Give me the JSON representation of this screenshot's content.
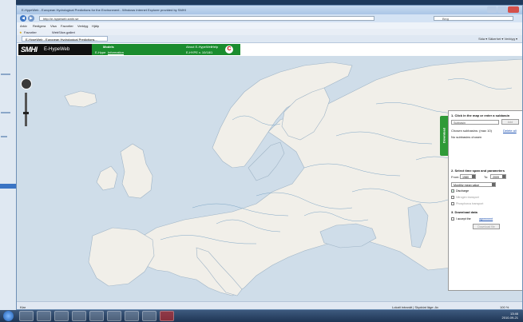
{
  "window": {
    "title": "E-HypeWeb - European Hydrological Predictions for the Environment - Windows Internet Explorer provided by SMHI"
  },
  "address": {
    "url": "http://e-hypeweb.smhi.se",
    "search_placeholder": "Bing"
  },
  "menu": [
    "Arkiv",
    "Redigera",
    "Visa",
    "Favoriter",
    "Verktyg",
    "Hjälp"
  ],
  "favorites": {
    "label": "Favoriter",
    "item": "WebSlice-galleri"
  },
  "tab": {
    "label": "E-HypeWeb - European Hydrological Predictions..."
  },
  "toolbar_right": "Sida ▾  Säkerhet ▾  Verktyg ▾",
  "app": {
    "logo": "SMHI",
    "name": "E-HypeWeb",
    "models": "Models",
    "ehype": "E-Hype",
    "information": "Information",
    "about": "About E-HypeWeb",
    "help": "Help",
    "version": "E-HYPE v. 10/18/1",
    "badge": "C"
  },
  "panel": {
    "tab_label": "Download",
    "step1": "1. Click in the map or enter a subbasin",
    "subbasin_placeholder": "Subbasin",
    "add_label": "Add",
    "chosen_label": "Chosen subbasins: (max 10)",
    "delete_all": "Delete all",
    "no_subbasin": "No subbasins chosen",
    "step2": "2. Select time span and parameters",
    "from_label": "From:",
    "from_value": "1980",
    "to_label": "To:",
    "to_value": "2009",
    "aggregation": "Monthly mean value",
    "params": [
      {
        "label": "Discharge",
        "checked": true
      },
      {
        "label": "Nitrogen transport",
        "checked": false
      },
      {
        "label": "Phosphorus transport",
        "checked": false
      }
    ],
    "step3": "3. Download data",
    "accept_prefix": "I accept the",
    "agreement": "agreement",
    "download_btn": "Download file"
  },
  "status": {
    "left": "Klar",
    "zone": "Lokalt intranät | Skyddat läge: Av",
    "zoom": "100 %"
  },
  "taskbar": {
    "time": "13:46",
    "date": "2010-09-21"
  }
}
